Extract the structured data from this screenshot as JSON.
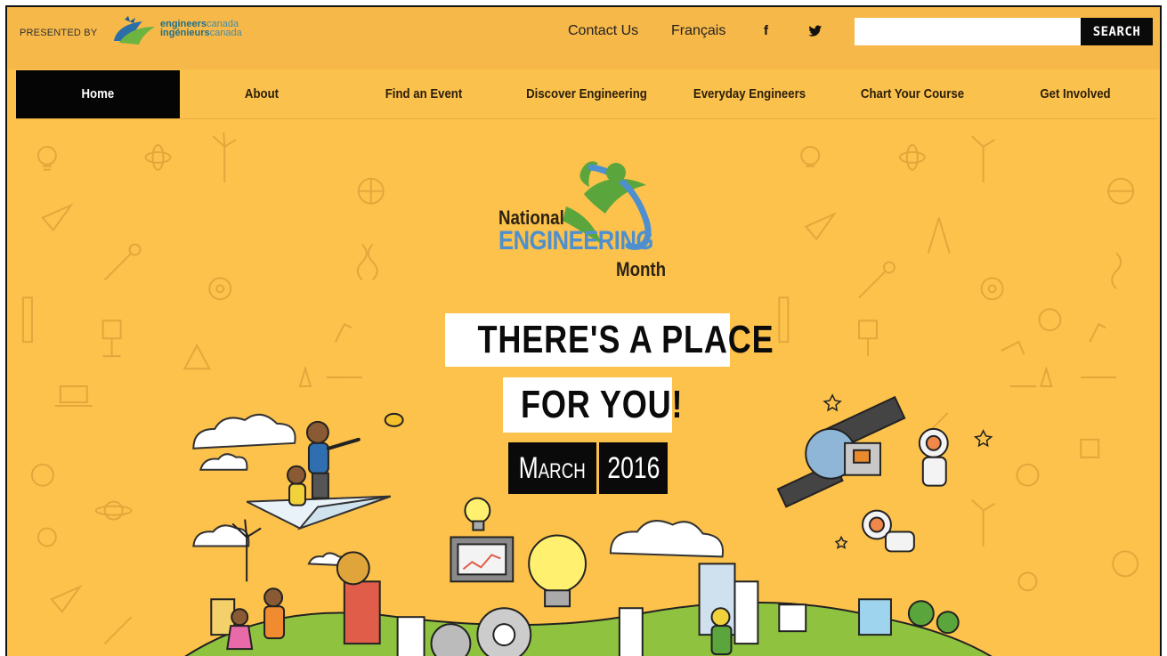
{
  "topbar": {
    "presented_by": "PRESENTED BY",
    "ec_logo_line1_bold": "engineers",
    "ec_logo_line1_light": "canada",
    "ec_logo_line2_bold": "ingénieurs",
    "ec_logo_line2_light": "canada",
    "contact": "Contact Us",
    "language": "Français",
    "facebook_glyph": "f",
    "twitter_icon": "twitter-icon",
    "search_placeholder": "",
    "search_label": "SEARCH"
  },
  "nav": {
    "items": [
      {
        "label": "Home",
        "active": true
      },
      {
        "label": "About"
      },
      {
        "label": "Find an Event"
      },
      {
        "label": "Discover Engineering"
      },
      {
        "label": "Everyday Engineers"
      },
      {
        "label": "Chart Your Course"
      },
      {
        "label": "Get Involved"
      }
    ]
  },
  "hero": {
    "logo_national": "National",
    "logo_engineering": "ENGINEERING",
    "logo_month": "Month",
    "headline_line1": "THERE'S A PLACE",
    "headline_line2": "FOR YOU!",
    "date_month": "March",
    "date_year": "2016"
  },
  "colors": {
    "background": "#fcc24b",
    "topbar": "#f6b848",
    "nav_active": "#050505",
    "engineering_blue": "#4e8fcf",
    "logo_green": "#5aa63c"
  }
}
